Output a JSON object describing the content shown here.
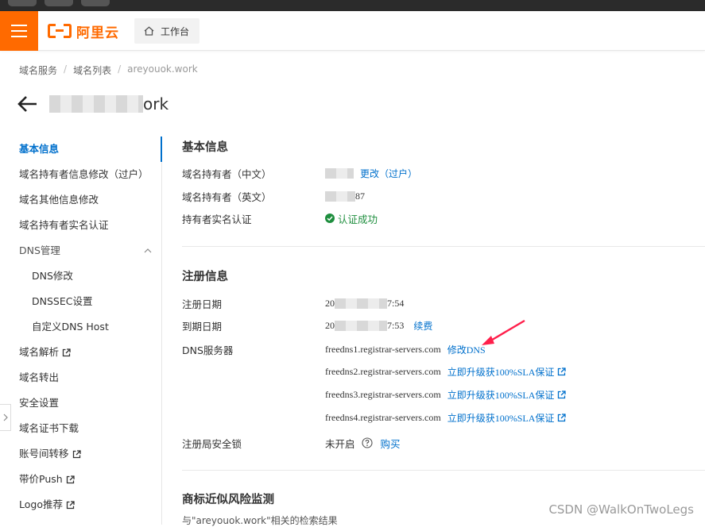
{
  "topbar": {
    "logo_text": "阿里云",
    "workbench_label": "工作台"
  },
  "breadcrumb": [
    "域名服务",
    "域名列表",
    "areyouok.work"
  ],
  "page": {
    "title_suffix": "ork"
  },
  "sidenav": {
    "items": [
      {
        "label": "基本信息"
      },
      {
        "label": "域名持有者信息修改（过户）"
      },
      {
        "label": "域名其他信息修改"
      },
      {
        "label": "域名持有者实名认证"
      },
      {
        "label": "DNS管理"
      },
      {
        "label": "DNS修改"
      },
      {
        "label": "DNSSEC设置"
      },
      {
        "label": "自定义DNS Host"
      },
      {
        "label": "域名解析"
      },
      {
        "label": "域名转出"
      },
      {
        "label": "安全设置"
      },
      {
        "label": "域名证书下载"
      },
      {
        "label": "账号间转移"
      },
      {
        "label": "带价Push"
      },
      {
        "label": "Logo推荐"
      }
    ]
  },
  "basic_info": {
    "title": "基本信息",
    "holder_cn_label": "域名持有者（中文）",
    "holder_cn_link": "更改（过户）",
    "holder_en_label": "域名持有者（英文）",
    "holder_en_suffix": "87",
    "verify_label": "持有者实名认证",
    "verify_status": "认证成功"
  },
  "registration": {
    "title": "注册信息",
    "reg_date_label": "注册日期",
    "reg_date_prefix": "20",
    "reg_date_suffix": "7:54",
    "exp_date_label": "到期日期",
    "exp_date_prefix": "20",
    "exp_date_suffix": "7:53",
    "renew_link": "续费",
    "dns_label": "DNS服务器",
    "dns_servers": [
      {
        "host": "freedns1.registrar-servers.com",
        "link": "修改DNS"
      },
      {
        "host": "freedns2.registrar-servers.com",
        "link": "立即升级获100%SLA保证"
      },
      {
        "host": "freedns3.registrar-servers.com",
        "link": "立即升级获100%SLA保证"
      },
      {
        "host": "freedns4.registrar-servers.com",
        "link": "立即升级获100%SLA保证"
      }
    ],
    "lock_label": "注册局安全锁",
    "lock_status": "未开启",
    "lock_link": "购买"
  },
  "trademark": {
    "title": "商标近似风险监测",
    "subtitle": "与\"areyouok.work\"相关的检索结果"
  },
  "watermark": "CSDN @WalkOnTwoLegs",
  "colors": {
    "brand": "#ff6a00",
    "link": "#0070cc",
    "success": "#1e8e3e",
    "annotation_arrow": "#ff1f4b"
  }
}
